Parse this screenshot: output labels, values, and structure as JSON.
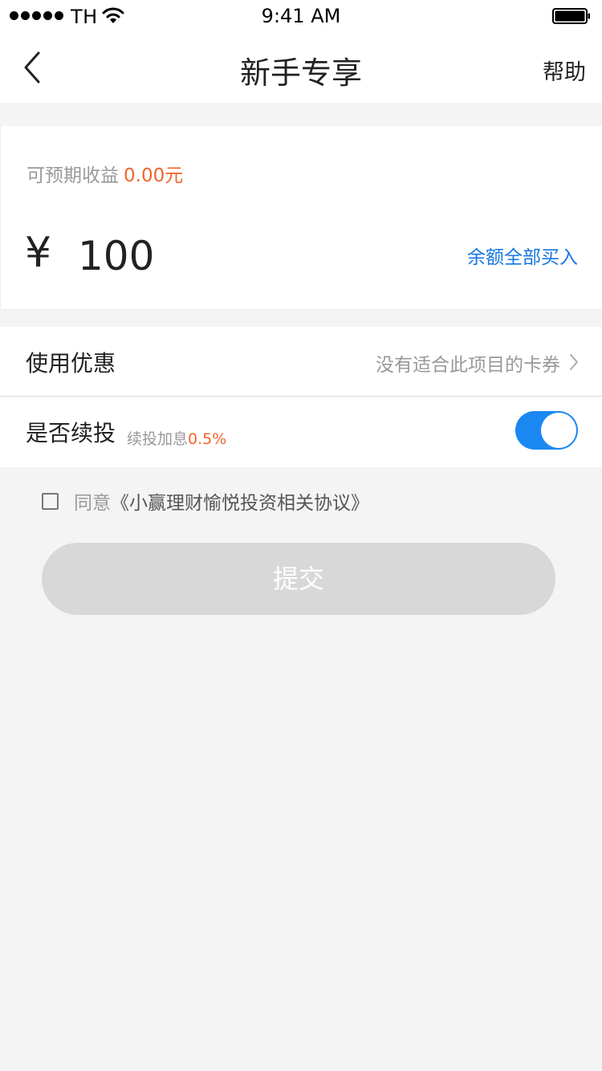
{
  "status_bar": {
    "carrier": "TH",
    "time": "9:41 AM"
  },
  "nav": {
    "title": "新手专享",
    "help_label": "帮助"
  },
  "income": {
    "label": "可预期收益",
    "value": "0.00元",
    "currency_symbol": "¥",
    "amount": "100",
    "buy_all_label": "余额全部买入"
  },
  "coupon": {
    "label": "使用优惠",
    "value": "没有适合此项目的卡券"
  },
  "reinvest": {
    "label": "是否续投",
    "note": "续投加息",
    "rate": "0.5%",
    "enabled": true
  },
  "agreement": {
    "prefix": "同意",
    "document": "《小赢理财愉悦投资相关协议》",
    "checked": false
  },
  "submit_label": "提交",
  "colors": {
    "accent_orange": "#f0652a",
    "link_blue": "#1677e0",
    "toggle_blue": "#1a88f0",
    "disabled_gray": "#d8d8d8",
    "background": "#f4f4f4"
  }
}
